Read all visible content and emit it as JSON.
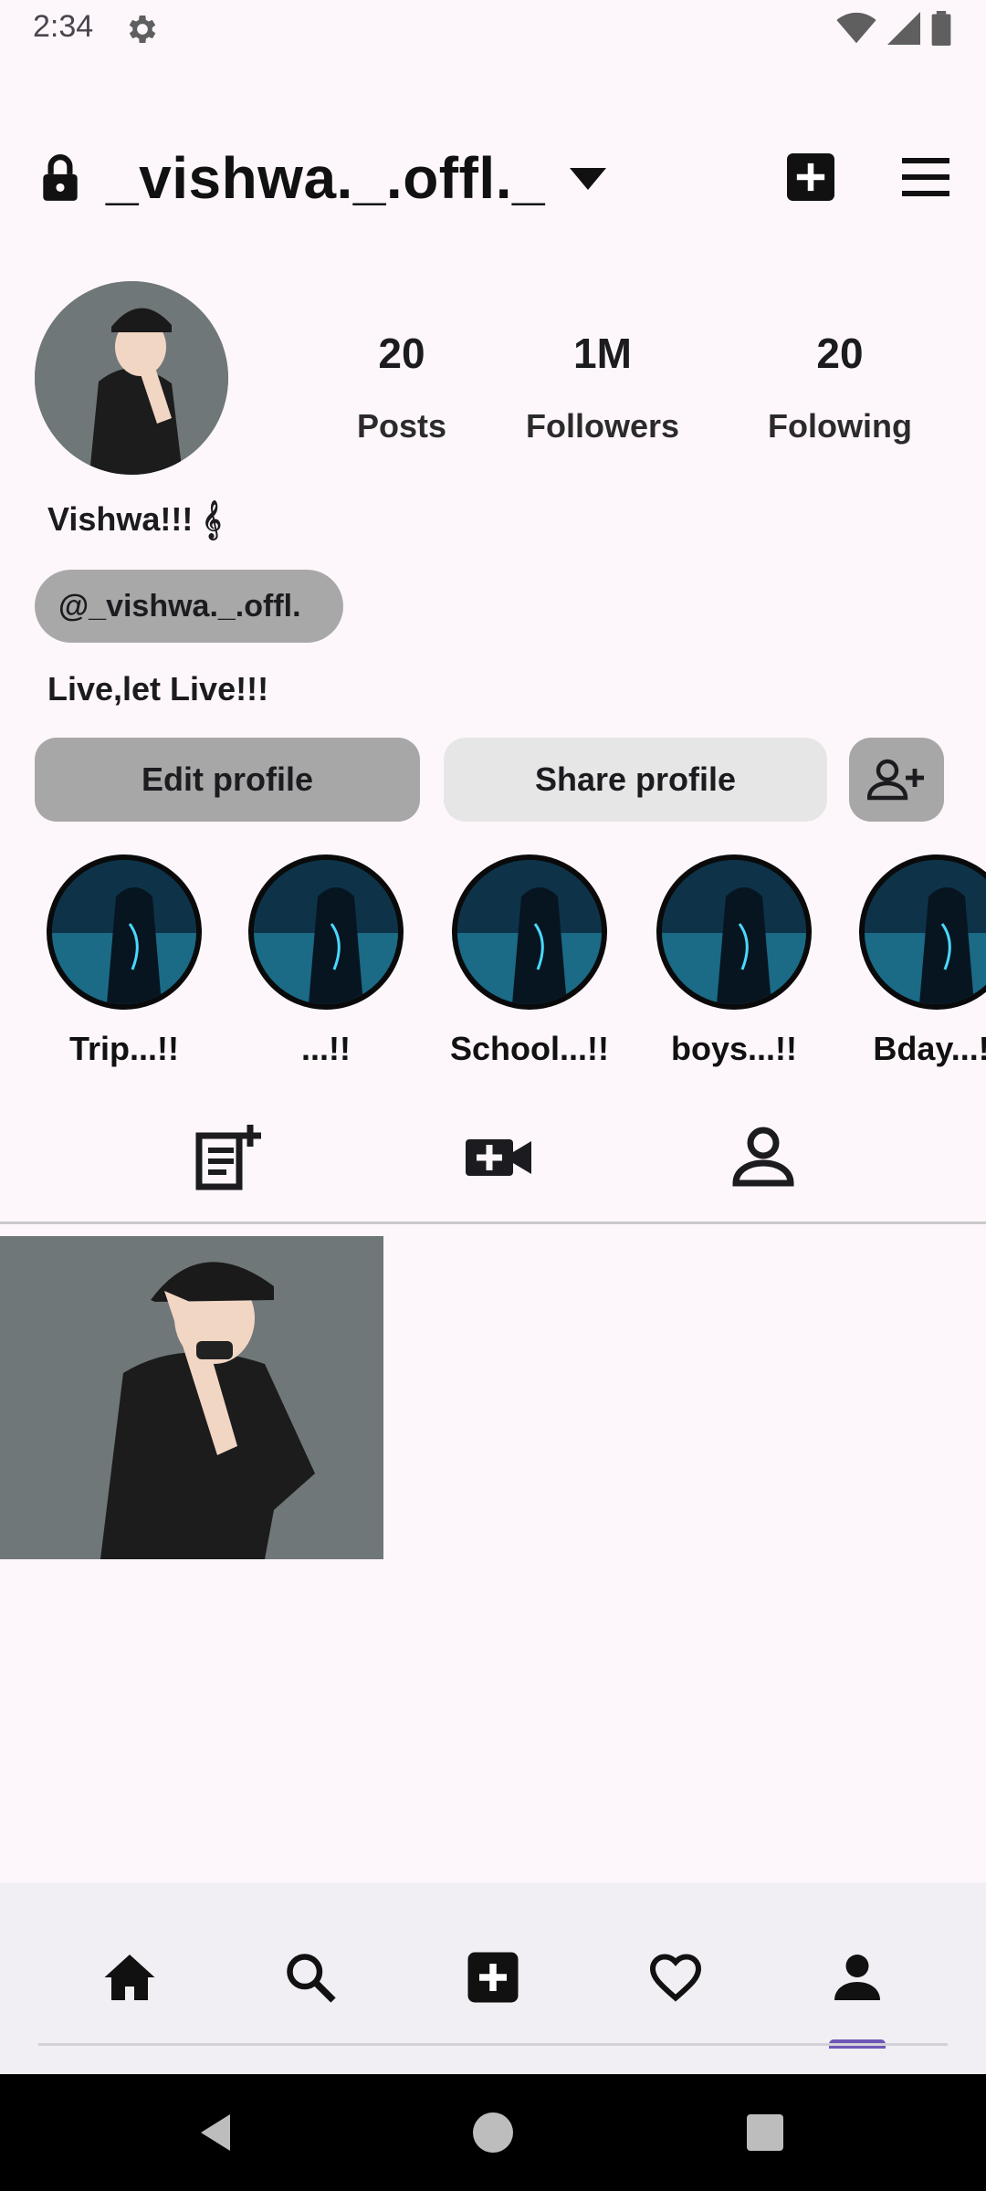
{
  "status_bar": {
    "time": "2:34",
    "icons": [
      "gear-icon",
      "wifi-icon",
      "signal-icon",
      "battery-icon"
    ]
  },
  "top_bar": {
    "username": "_vishwa._.offl._",
    "icons": [
      "lock-icon",
      "chevron-down-icon",
      "add-box-icon",
      "menu-icon"
    ]
  },
  "profile": {
    "stats": [
      {
        "value": "20",
        "label": "Posts"
      },
      {
        "value": "1M",
        "label": "Followers"
      },
      {
        "value": "20",
        "label": "Folowing"
      }
    ],
    "display_name": "Vishwa!!! 𝄞",
    "handle": "@_vishwa._.offl.",
    "bio": "Live,let Live!!!"
  },
  "buttons": {
    "edit": "Edit profile",
    "share": "Share profile",
    "add_user_icon": "person-add-icon"
  },
  "highlights": [
    {
      "label": "Trip...!!"
    },
    {
      "label": "...!!"
    },
    {
      "label": "School...!!"
    },
    {
      "label": "boys...!!"
    },
    {
      "label": "Bday...!!"
    }
  ],
  "tabs": [
    "post-add-icon",
    "video-add-icon",
    "tagged-person-icon"
  ],
  "bottom_nav": [
    "home-icon",
    "search-icon",
    "add-box-icon",
    "heart-icon",
    "profile-icon"
  ],
  "colors": {
    "background": "#fdf7fb",
    "chip": "#a8a8a8",
    "share_button": "#e6e6e6",
    "nav_indicator": "#6e57b8",
    "bottom_nav": "#f1eff4"
  }
}
